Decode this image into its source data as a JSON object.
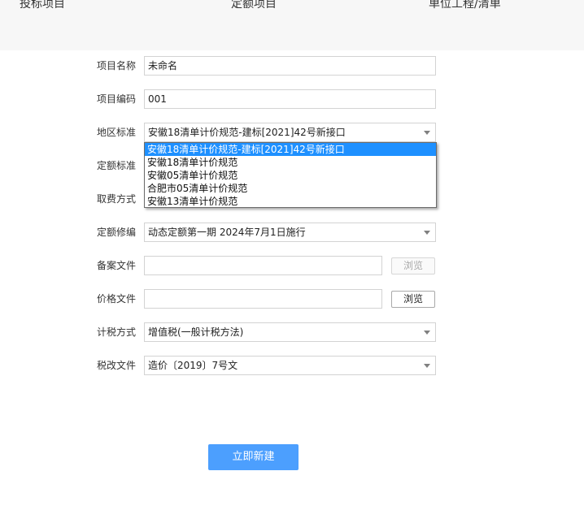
{
  "tabs": [
    "投标项目",
    "定额项目",
    "单位工程/清单"
  ],
  "form": {
    "project_name": {
      "label": "项目名称",
      "value": "未命名"
    },
    "project_code": {
      "label": "项目编码",
      "value": "001"
    },
    "region_standard": {
      "label": "地区标准",
      "value": "安徽18清单计价规范-建标[2021]42号新接口",
      "options": [
        "安徽18清单计价规范-建标[2021]42号新接口",
        "安徽18清单计价规范",
        "安徽05清单计价规范",
        "合肥市05清单计价规范",
        "安徽13清单计价规范"
      ],
      "selected_index": 0
    },
    "quota_standard": {
      "label": "定额标准"
    },
    "fee_method": {
      "label": "取费方式"
    },
    "quota_edition": {
      "label": "定额修编",
      "value": "动态定额第一期 2024年7月1日施行"
    },
    "record_file": {
      "label": "备案文件",
      "value": "",
      "browse_label": "浏览"
    },
    "price_file": {
      "label": "价格文件",
      "value": "",
      "browse_label": "浏览"
    },
    "tax_method": {
      "label": "计税方式",
      "value": "增值税(一般计税方法)"
    },
    "tax_reform_file": {
      "label": "税改文件",
      "value": "造价〔2019〕7号文"
    }
  },
  "submit_label": "立即新建",
  "colors": {
    "primary": "#4c9ffe",
    "selected_option": "#1e90ff",
    "tabbar_bg": "#f7f7f7"
  }
}
